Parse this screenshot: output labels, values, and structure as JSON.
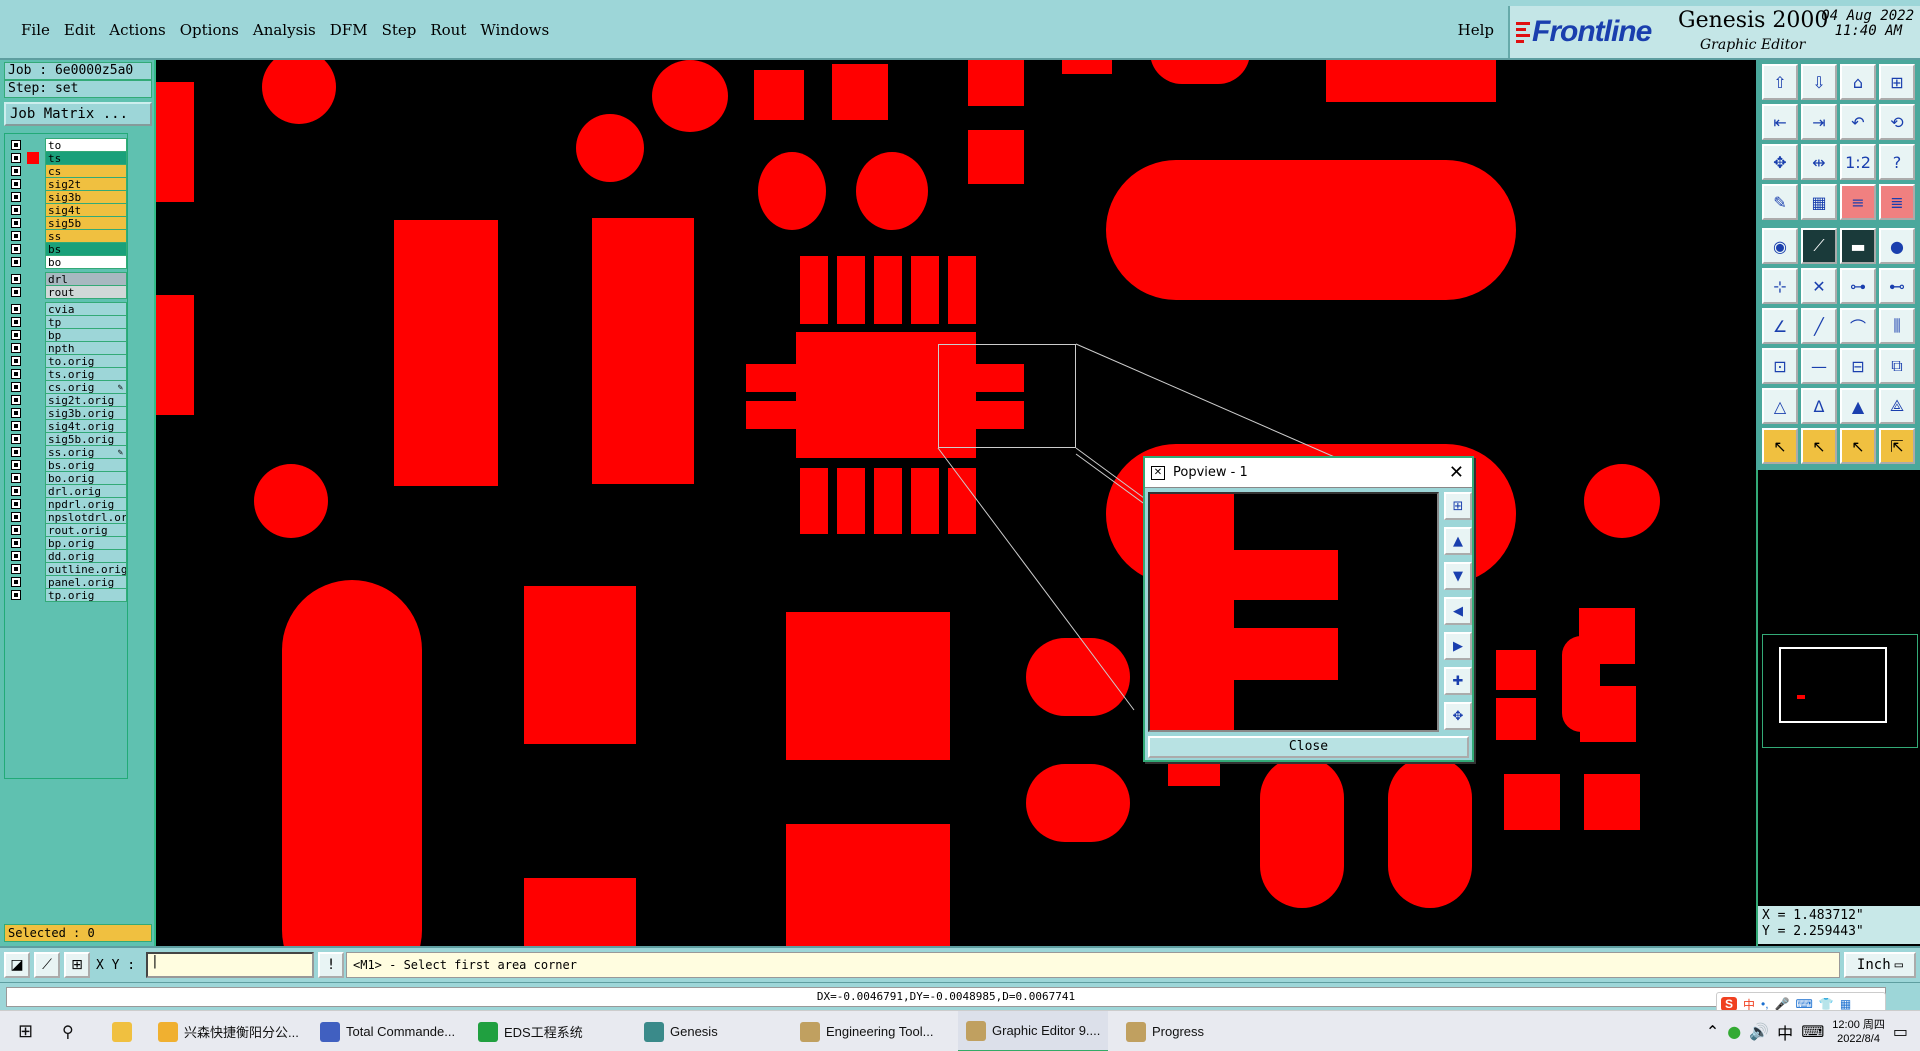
{
  "menubar": {
    "items": [
      "File",
      "Edit",
      "Actions",
      "Options",
      "Analysis",
      "DFM",
      "Step",
      "Rout",
      "Windows"
    ],
    "help": "Help"
  },
  "brand": {
    "logo_text": "Frontline",
    "product": "Genesis 2000",
    "module": "Graphic Editor",
    "date": "04 Aug 2022",
    "time": "11:40 AM",
    "logo_color": "#1a3fae",
    "accent_color": "#e01010"
  },
  "left": {
    "job": "Job : 6e0000z5a0",
    "step": "Step: set",
    "job_matrix": "Job Matrix ...",
    "selected": "Selected : 0"
  },
  "layers": [
    {
      "name": "to",
      "color": "#ffffff"
    },
    {
      "name": "ts",
      "color": "#1aa07a",
      "active": true
    },
    {
      "name": "cs",
      "color": "#f0c040"
    },
    {
      "name": "sig2t",
      "color": "#f0c040"
    },
    {
      "name": "sig3b",
      "color": "#f0c040"
    },
    {
      "name": "sig4t",
      "color": "#f0c040"
    },
    {
      "name": "sig5b",
      "color": "#f0c040"
    },
    {
      "name": "ss",
      "color": "#f0c040"
    },
    {
      "name": "bs",
      "color": "#1aa07a"
    },
    {
      "name": "bo",
      "color": "#ffffff"
    },
    {
      "name": "drl",
      "color": "#a8b8c0"
    },
    {
      "name": "rout",
      "color": "#d0d8d8"
    },
    {
      "name": "cvia",
      "color": "#9dd6d8"
    },
    {
      "name": "tp",
      "color": "#9dd6d8"
    },
    {
      "name": "bp",
      "color": "#9dd6d8"
    },
    {
      "name": "npth",
      "color": "#9dd6d8"
    },
    {
      "name": "to.orig",
      "color": "#9dd6d8"
    },
    {
      "name": "ts.orig",
      "color": "#9dd6d8"
    },
    {
      "name": "cs.orig",
      "color": "#9dd6d8",
      "edited": true
    },
    {
      "name": "sig2t.orig",
      "color": "#9dd6d8"
    },
    {
      "name": "sig3b.orig",
      "color": "#9dd6d8"
    },
    {
      "name": "sig4t.orig",
      "color": "#9dd6d8"
    },
    {
      "name": "sig5b.orig",
      "color": "#9dd6d8"
    },
    {
      "name": "ss.orig",
      "color": "#9dd6d8",
      "edited": true
    },
    {
      "name": "bs.orig",
      "color": "#9dd6d8"
    },
    {
      "name": "bo.orig",
      "color": "#9dd6d8"
    },
    {
      "name": "drl.orig",
      "color": "#9dd6d8"
    },
    {
      "name": "npdrl.orig",
      "color": "#9dd6d8"
    },
    {
      "name": "npslotdrl.orig",
      "color": "#9dd6d8"
    },
    {
      "name": "rout.orig",
      "color": "#9dd6d8"
    },
    {
      "name": "bp.orig",
      "color": "#9dd6d8"
    },
    {
      "name": "dd.orig",
      "color": "#9dd6d8"
    },
    {
      "name": "outline.orig",
      "color": "#9dd6d8"
    },
    {
      "name": "panel.orig",
      "color": "#9dd6d8"
    },
    {
      "name": "tp.orig",
      "color": "#9dd6d8"
    }
  ],
  "canvas": {
    "feature_color": "#ff0000",
    "background": "#000000"
  },
  "popview": {
    "title": "Popview - 1",
    "close_label": "Close"
  },
  "coords": {
    "x": "X = 1.483712\"",
    "y": "Y = 2.259443\""
  },
  "cmdbar": {
    "xy_label": "X Y :",
    "prompt": "<M1> - Select first area corner",
    "unit": "Inch"
  },
  "measure": "DX=-0.0046791,DY=-0.0048985,D=0.0067741",
  "taskbar": {
    "items": [
      {
        "label": "兴森快捷衡阳分公...",
        "icon": "folder-icon",
        "color": "#f0b030"
      },
      {
        "label": "Total Commande...",
        "icon": "disk-icon",
        "color": "#4060c0"
      },
      {
        "label": "EDS工程系统",
        "icon": "eds-icon",
        "color": "#20a040"
      },
      {
        "label": "Genesis",
        "icon": "genesis-icon",
        "color": "#3a8a8a"
      },
      {
        "label": "Engineering Tool...",
        "icon": "x-window-icon",
        "color": "#c0a060"
      },
      {
        "label": "Graphic Editor 9....",
        "icon": "x-window-icon",
        "color": "#c0a060",
        "active": true
      },
      {
        "label": "Progress",
        "icon": "x-window-icon",
        "color": "#c0a060"
      }
    ],
    "ime": "中",
    "clock_time": "12:00 周四",
    "clock_date": "2022/8/4"
  }
}
